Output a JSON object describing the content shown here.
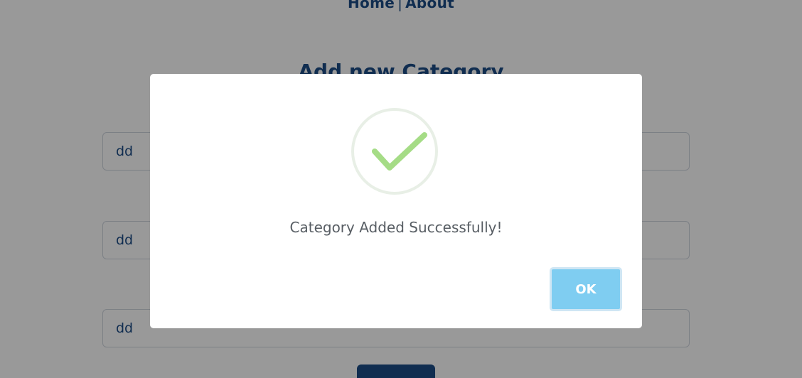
{
  "nav": {
    "home_label": "Home",
    "separator": "|",
    "about_label": "About"
  },
  "page": {
    "heading": "Add new Category"
  },
  "form": {
    "fields": [
      {
        "value": "dd"
      },
      {
        "value": "dd"
      },
      {
        "value": "dd"
      }
    ],
    "submit_label": ""
  },
  "dialog": {
    "icon": "check-icon",
    "message": "Category Added Successfully!",
    "ok_label": "OK",
    "colors": {
      "ok_button": "#7fcdf1",
      "check": "#a5dc86",
      "overlay": "rgba(0,0,0,0.4)",
      "brand": "#1c4c86"
    }
  }
}
